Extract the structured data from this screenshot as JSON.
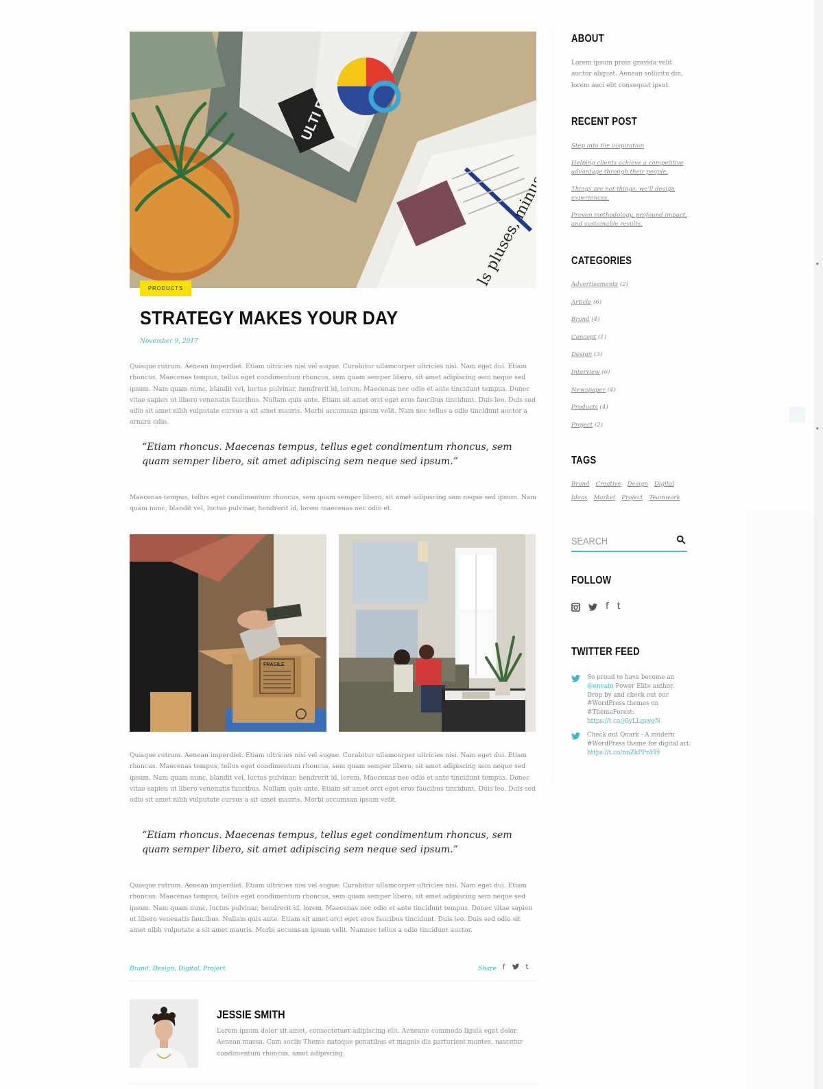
{
  "post": {
    "category_badge": "PRODUCTS",
    "title": "STRATEGY MAKES YOUR DAY",
    "date": "November 9, 2017",
    "para1": "Quisque rutrum. Aenean imperdiet. Etiam ultricies nisi vel augue. Curabitur ullamcorper ultricies nisi. Nam eget dui. Etiam rhoncus. Maecenas tempus, tellus eget condimentum rhoncus, sem quam semper libero, sit amet adipiscing sem neque sed ipsum. Nam quam nunc, blandit vel, luctus pulvinar, hendrerit id, lorem. Maecenas nec odio et ante tincidunt tempus. Donec vitae sapien ut libero venenatis faucibus. Nullam quis ante. Etiam sit amet orci eget eros faucibus tincidunt. Duis leo. Duis sed odio sit amet nibh vulputate cursus a sit amet mauris. Morbi accumsan ipsum velit. Nam nec tellus a odio tincidunt auctor a ornare odio.",
    "quote1": "“Etiam rhoncus. Maecenas tempus, tellus eget condimentum rhoncus, sem quam semper libero, sit amet adipiscing sem neque sed ipsum.”",
    "para2": "Maecenas tempus, tellus eget condimentum rhoncus, sem quam semper libero, sit amet adipiscing sem neque sed ipsum. Nam quam nunc, blandit vel, luctus pulvinar, hendrerit id, lorem maecenas nec odio et.",
    "para3": "Quisque rutrum. Aenean imperdiet. Etiam ultricies nisi vel augue. Curabitur ullamcorper ultricies nisi. Nam eget dui. Etiam rhoncus. Maecenas tempus, tellus eget condimentum rhoncus, sem quam semper libero, sit amet adipiscing sem neque sed ipsum. Nam quam nunc, blandit vel, luctus pulvinar, hendrerit id, lorem. Maecenas nec odio et ante tincidunt tempus. Donec vitae sapien ut libero venenatis faucibus. Nullam quis ante. Etiam sit amet orci eget eros faucibus tincidunt. Duis leo. Duis sed odio sit amet nibh vulputate cursus a sit amet mauris. Morbi accumsan ipsum velit.",
    "quote2": "“Etiam rhoncus. Maecenas tempus, tellus eget condimentum rhoncus, sem quam semper libero, sit amet adipiscing sem neque sed ipsum.”",
    "para4": "Quisque rutrum. Aenean imperdiet. Etiam ultricies nisi vel augue. Curabitur ullamcorper ultricies nisi. Nam eget dui. Etiam rhoncus. Maecenas tempus, tellus eget condimentum rhoncus, sem quam semper libero, sit amet adipiscing sem neque sed ipsum. Nam quam nunc, luctus pulvinar, hendrerit id, lorem. Maecenas nec odio et ante tincidunt tempus. Donec vitae sapien ut libero venenatis faucibus. Nullam quis ante. Etiam sit amet orci eget eros faucibus tincidunt. Duis leo. Duis sed odio sit amet nibh vulputate a sit amet mauris. Morbi accumsan ipsum velit. Namnec tellus a odio tincidunt auctor.",
    "footer_tags": "Brand, Design, Digital, Project",
    "share_label": "Share",
    "share_icons": [
      "facebook-icon",
      "twitter-icon",
      "tumblr-icon"
    ]
  },
  "author": {
    "name": "JESSIE SMITH",
    "bio": "Lorem ipsum dolor sit amet, consectetuer adipiscing elit. Aeneane commodo ligula eget dolor. Aenean massa. Cum sociis Theme natoque penatibus et magnis dis parturient montes, nascetur condimentum rhoncus, amet adipiscing."
  },
  "sidebar": {
    "about": {
      "title": "ABOUT",
      "text": "Lorem ipsum proin gravida velit auctor aliquet. Aenean sollicitu din, lorem auci elit consequat ipsut."
    },
    "recent": {
      "title": "RECENT POST",
      "links": [
        "Step into the inspiration",
        "Helping clients achieve a competitive advantage through their people.",
        "Things are not things, we’ll design experiences.",
        "Proven methodology, profound impact, and sustainable results."
      ]
    },
    "categories": {
      "title": "CATEGORIES",
      "items": [
        {
          "name": "Advertisements",
          "count": "(2)"
        },
        {
          "name": "Article",
          "count": "(6)"
        },
        {
          "name": "Brand",
          "count": "(4)"
        },
        {
          "name": "Concept",
          "count": "(1)"
        },
        {
          "name": "Design",
          "count": "(3)"
        },
        {
          "name": "Interview",
          "count": "(6)"
        },
        {
          "name": "Newspaper",
          "count": "(4)"
        },
        {
          "name": "Products",
          "count": "(4)"
        },
        {
          "name": "Project",
          "count": "(2)"
        }
      ]
    },
    "tags": {
      "title": "TAGS",
      "items": [
        "Brand",
        "Creative",
        "Design",
        "Digital",
        "Ideas",
        "Market",
        "Project",
        "Teamwork"
      ]
    },
    "search": {
      "placeholder": "SEARCH"
    },
    "follow": {
      "title": "FOLLOW",
      "icons": [
        "instagram-icon",
        "twitter-icon",
        "facebook-icon",
        "tumblr-icon"
      ]
    },
    "twitter": {
      "title": "TWITTER FEED",
      "tweets": [
        {
          "pre": "So proud to have become an ",
          "mention": "@envato",
          "post": " Power Elite author. Drop by and check out our #WordPress themes on #ThemeForest: ",
          "link": "https://t.co/jGyLLgeygN"
        },
        {
          "pre": "Check out Quark - A modern #WordPress theme for digital art: ",
          "mention": "",
          "post": "",
          "link": "https://t.co/nnZkPPnYI9"
        }
      ]
    }
  },
  "colors": {
    "accent": "#3cb8c7",
    "badge": "#f6e007",
    "heading": "#111111",
    "body_text": "#888888"
  }
}
